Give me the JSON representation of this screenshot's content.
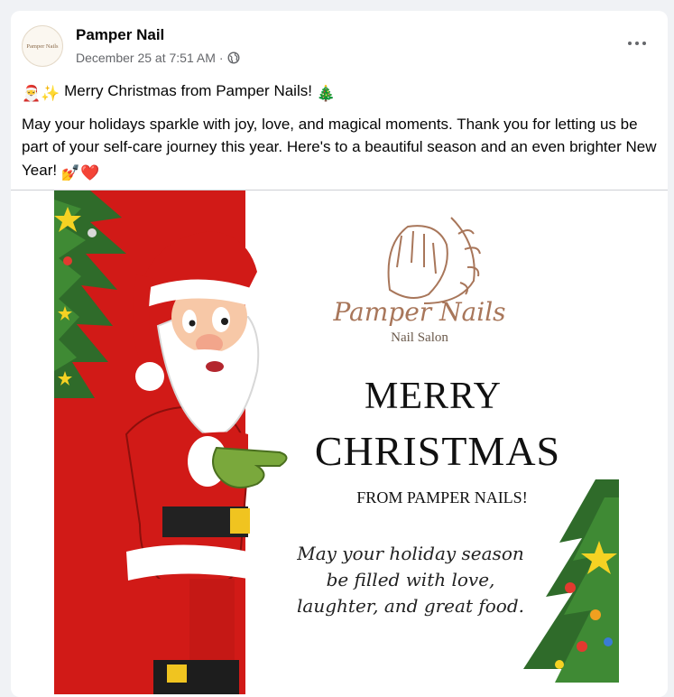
{
  "post": {
    "author": "Pamper Nail",
    "avatar_text": "Pamper Nails",
    "date": "December 25 at 7:51 AM",
    "separator": "·",
    "privacy_icon": "globe-icon",
    "more_icon": "more-options-icon",
    "text_line1_emojis": "🎅✨",
    "text_line1": "Merry Christmas from Pamper Nails!",
    "text_line1_trailing_emoji": "🎄",
    "text_body": "May your holidays sparkle with joy, love, and magical moments. Thank you for letting us be part of your self-care journey this year. Here's to a beautiful season and an even brighter New Year!",
    "text_body_emojis": "💅❤️"
  },
  "image": {
    "brand_name": "Pamper Nails",
    "brand_subtitle": "Nail Salon",
    "headline_1": "MERRY",
    "headline_2": "CHRISTMAS",
    "from_line": "FROM PAMPER NAILS!",
    "wish_1": "May your holiday season",
    "wish_2": "be filled with love,",
    "wish_3": "laughter, and great food.",
    "colors": {
      "red_panel": "#d11a17",
      "brand": "#a8765a",
      "tree_green": "#2f6b2a",
      "santa_glove": "#7aa83c"
    }
  }
}
